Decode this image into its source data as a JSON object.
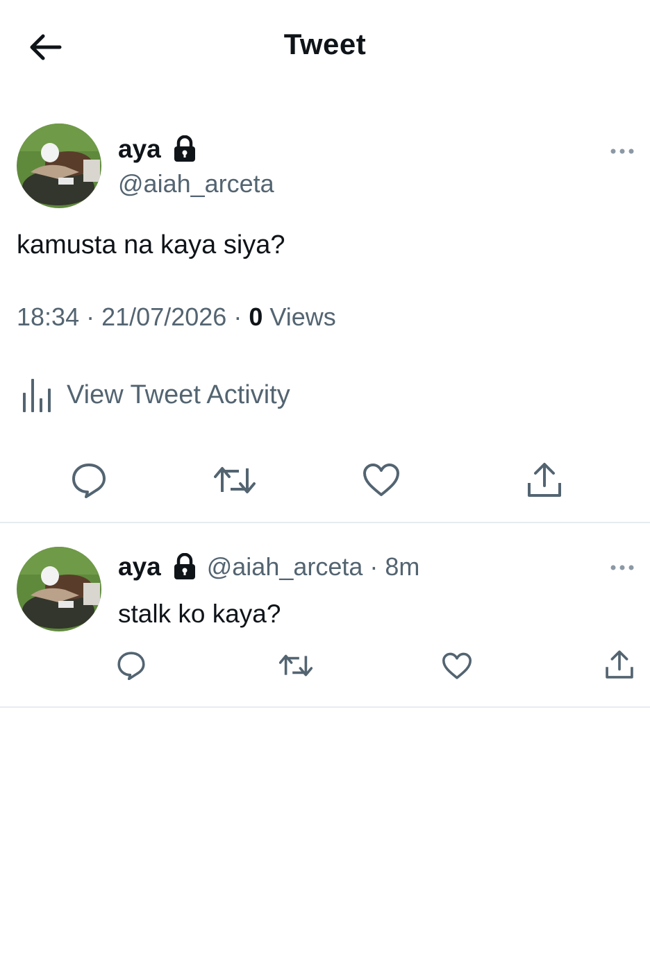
{
  "header": {
    "title": "Tweet",
    "back_icon": "arrow-left-icon"
  },
  "main_tweet": {
    "author_name": "aya",
    "handle": "@aiah_arceta",
    "text": "kamusta na kaya siya?",
    "time": "18:34",
    "date": "21/07/2026",
    "views_count": "0",
    "views_label": "Views",
    "separator": "·",
    "activity_label": "View Tweet Activity",
    "actions": [
      "reply-icon",
      "retweet-icon",
      "like-icon",
      "share-icon"
    ]
  },
  "reply_tweet": {
    "author_name": "aya",
    "handle": "@aiah_arceta",
    "age": "· 8m",
    "text": "stalk ko kaya?"
  },
  "colors": {
    "text": "#0f1419",
    "secondary": "#536471",
    "divider": "#e6ecf0"
  }
}
